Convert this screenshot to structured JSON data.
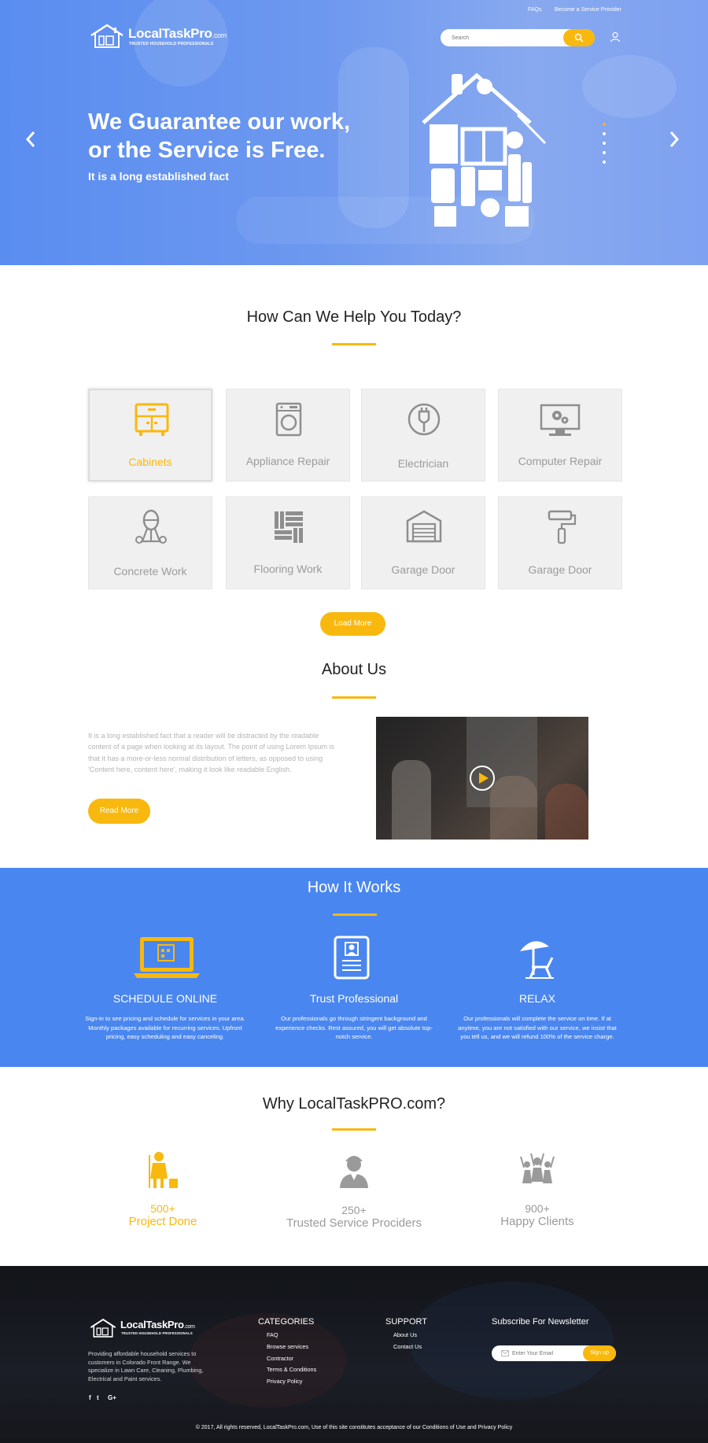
{
  "topbar": {
    "faqs": "FAQs",
    "become_provider": "Become a Service Provider"
  },
  "brand": {
    "name": "LocalTaskPro",
    "tld": ".com",
    "tagline": "TRUSTED HOUSEHOLD PROFESSIONALS"
  },
  "search": {
    "placeholder": "Search"
  },
  "hero": {
    "title_line1": "We Guarantee our work,",
    "title_line2": "or the Service is Free.",
    "subtitle": "It is a long established fact"
  },
  "services": {
    "title": "How Can We Help You Today?",
    "items": [
      {
        "label": "Cabinets",
        "icon": "cabinet-icon"
      },
      {
        "label": "Appliance Repair",
        "icon": "washing-machine-icon"
      },
      {
        "label": "Electrician",
        "icon": "plug-icon"
      },
      {
        "label": "Computer Repair",
        "icon": "monitor-gear-icon"
      },
      {
        "label": "Concrete Work",
        "icon": "concrete-mixer-icon"
      },
      {
        "label": "Flooring Work",
        "icon": "flooring-icon"
      },
      {
        "label": "Garage Door",
        "icon": "garage-door-icon"
      },
      {
        "label": "Garage Door",
        "icon": "paint-roller-icon"
      }
    ],
    "load_more": "Load More"
  },
  "about": {
    "title": "About Us",
    "text": "It is a long established fact that a reader will be distracted by the readable content of a page when looking at its layout. The point of using Lorem Ipsum is that it has a more-or-less normal distribution of letters, as opposed to using 'Content here, content here', making it look like readable English.",
    "read_more": "Read More"
  },
  "how_it_works": {
    "title": "How It Works",
    "steps": [
      {
        "title": "SCHEDULE ONLINE",
        "text": "Sign-in to see pricing and schedule for services in your area. Monthly packages available for recurring services. Upfront pricing, easy scheduling and easy canceling.",
        "icon": "laptop-calendar-icon"
      },
      {
        "title": "Trust Professional",
        "text": "Our professionals go through stringent background and experience checks. Rest assured, you will get absolute top-notch service.",
        "icon": "id-badge-icon"
      },
      {
        "title": "RELAX",
        "text": "Our professionals will complete the service on time. If at anytime, you are not satisfied with our service, we insist that you tell us, and we will refund 100% of the service charge.",
        "icon": "beach-umbrella-chair-icon"
      }
    ]
  },
  "why": {
    "title": "Why LocalTaskPRO.com?",
    "stats": [
      {
        "number": "500+",
        "label": "Project Done",
        "icon": "cleaner-icon"
      },
      {
        "number": "250+",
        "label": "Trusted Service Prociders",
        "icon": "worker-icon"
      },
      {
        "number": "900+",
        "label": "Happy Clients",
        "icon": "happy-crowd-icon"
      }
    ]
  },
  "footer": {
    "description": "Providing affordable household services to customers in Colorado Front Range. We specialize in Lawn Care, Cleaning, Plumbing, Electrical and Paint services.",
    "categories_title": "CATEGORIES",
    "categories": [
      "FAQ",
      "Browse services",
      "Contractor",
      "Terms & Conditions",
      "Privacy Policy"
    ],
    "support_title": "SUPPORT",
    "support": [
      "About Us",
      "Contact Us"
    ],
    "newsletter_title": "Subscribe For Newsletter",
    "newsletter_placeholder": "Enter Your Email",
    "newsletter_button": "Sign up",
    "social": [
      "f",
      "t",
      "G+"
    ],
    "copyright": "© 2017, All rights reserved, LocalTaskPro.com, Use of this site constitutes acceptance of our Conditions of Use and Privacy Policy"
  },
  "colors": {
    "accent": "#f8b80e",
    "hero_blue": "#5a8df0",
    "section_blue": "#4a86ef",
    "footer_dark": "#15171c"
  }
}
